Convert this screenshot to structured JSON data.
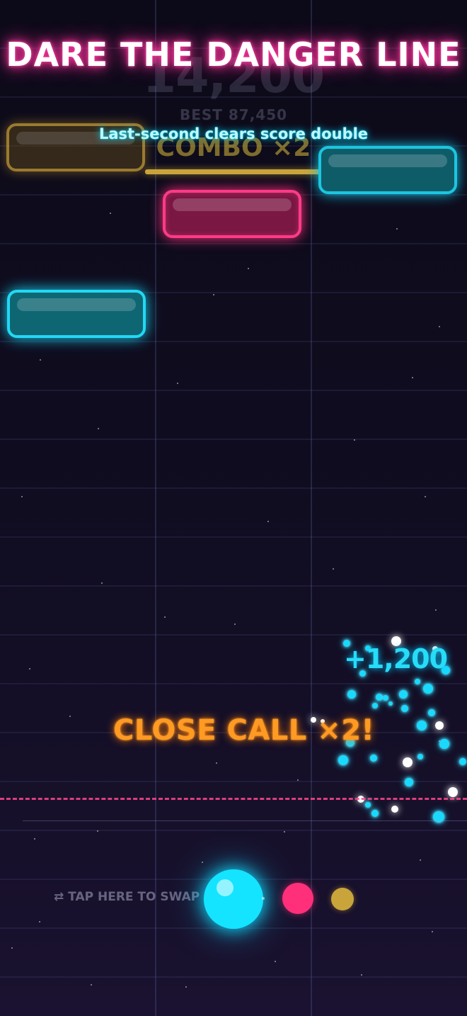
{
  "hud": {
    "score": "14,200",
    "best": "BEST 87,450",
    "combo": "COMBO ×2",
    "level_progress": 0.5
  },
  "banner": {
    "headline": "DARE THE DANGER LINE",
    "subhead": "Last-second clears score double"
  },
  "feedback": {
    "close_call": "CLOSE CALL ×2!",
    "points": "+1,200"
  },
  "controls": {
    "swap_hint": "⇄ TAP HERE TO SWAP"
  },
  "blocks": [
    {
      "lane": 1,
      "color": "#c9a038",
      "state": "faded"
    },
    {
      "lane": 2,
      "color": "#ff3b86"
    },
    {
      "lane": 3,
      "color": "#1cc6e0"
    },
    {
      "lane": 1,
      "color": "#22d8f4"
    }
  ],
  "player": {
    "current_color": "#14e4ff",
    "queue_colors": [
      "#ff2f7a",
      "#c9a43a"
    ]
  },
  "colors": {
    "danger_line": "#ff468c",
    "close_call": "#ff9a22",
    "points": "#27dcf7",
    "headline_glow": "#ff2f9a"
  }
}
